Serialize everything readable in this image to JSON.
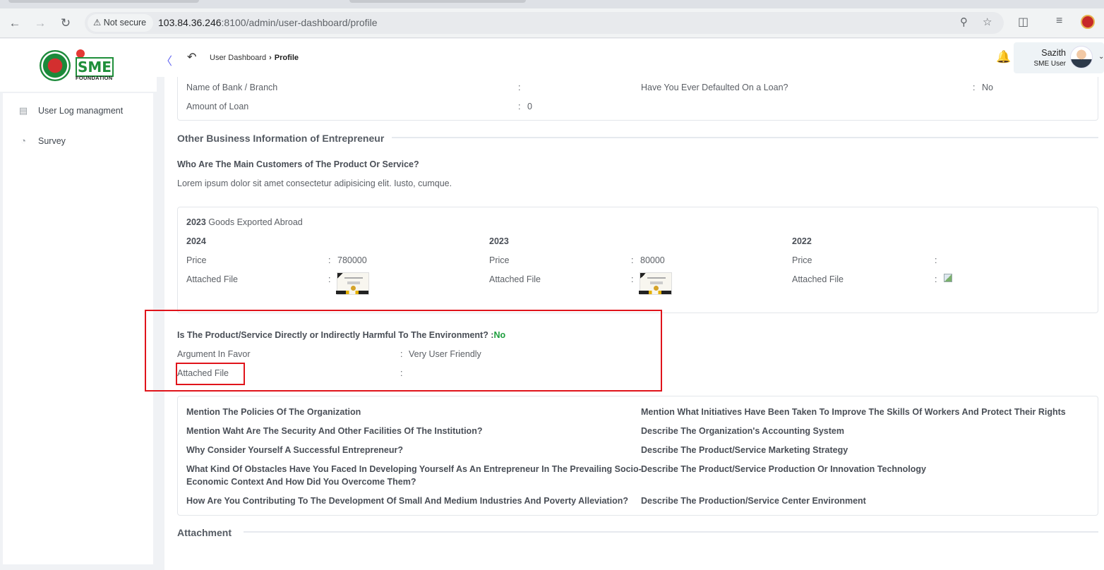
{
  "browser": {
    "security_label": "Not secure",
    "url_host": "103.84.36.246",
    "url_path": ":8100/admin/user-dashboard/profile"
  },
  "logo": {
    "text": "SME",
    "subtext": "FOUNDATION"
  },
  "header": {
    "breadcrumb_parent": "User Dashboard",
    "breadcrumb_current": "Profile",
    "user_name": "Sazith",
    "user_role": "SME User"
  },
  "sidebar": {
    "items": [
      {
        "label": "User Log managment",
        "icon": "log-icon"
      },
      {
        "label": "Survey",
        "icon": "pie-chart-icon"
      }
    ]
  },
  "loan": {
    "bank_label": "Name of Bank / Branch",
    "bank_value": "",
    "defaulted_label": "Have You Ever Defaulted On a Loan?",
    "defaulted_value": "No",
    "amount_label": "Amount of Loan",
    "amount_value": "0"
  },
  "other_business": {
    "title": "Other Business Information of Entrepreneur",
    "customers_question": "Who Are The Main Customers of The Product Or Service?",
    "customers_answer": "Lorem ipsum dolor sit amet consectetur adipisicing elit. Iusto, cumque."
  },
  "exports": {
    "year": "2023",
    "title_rest": "Goods Exported Abroad",
    "price_label": "Price",
    "file_label": "Attached File",
    "columns": [
      {
        "year": "2024",
        "price": "780000",
        "file": "certificate"
      },
      {
        "year": "2023",
        "price": "80000",
        "file": "certificate"
      },
      {
        "year": "2022",
        "price": "",
        "file": "broken"
      }
    ]
  },
  "environment": {
    "question": "Is The Product/Service Directly or Indirectly Harmful To The Environment? :",
    "answer": "No",
    "argument_label": "Argument In Favor",
    "argument_value": "Very User Friendly",
    "file_label": "Attached File",
    "file_value": ""
  },
  "questions": {
    "left": [
      "Mention The Policies Of The Organization",
      "Mention Waht Are The Security And Other Facilities Of The Institution?",
      "Why Consider Yourself A Successful Entrepreneur?",
      "What Kind Of Obstacles Have You Faced In Developing Yourself As An Entrepreneur In The Prevailing Socio-",
      "Economic Context And How Did You Overcome Them?",
      "How Are You Contributing To The Development Of Small And Medium Industries And Poverty Alleviation?"
    ],
    "right": [
      "Mention What Initiatives Have Been Taken To Improve The Skills Of Workers And Protect Their Rights",
      "Describe The Organization's Accounting System",
      "Describe The Product/Service Marketing Strategy",
      "Describe The Product/Service Production Or Innovation Technology",
      "Describe The Production/Service Center Environment"
    ]
  },
  "attachment": {
    "title": "Attachment"
  },
  "colors": {
    "highlight": "#e0141b",
    "green": "#1e9e3e",
    "accent": "#6366f1"
  }
}
